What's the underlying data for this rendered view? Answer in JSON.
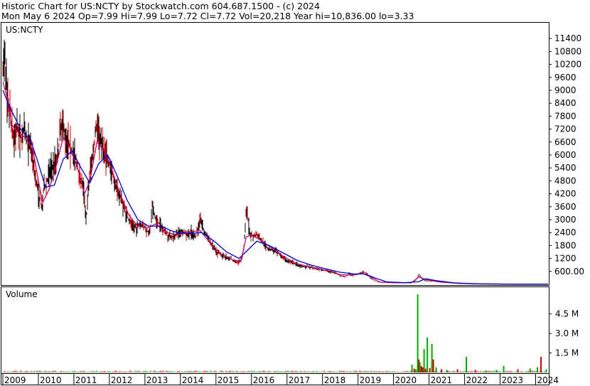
{
  "header": {
    "line1": "Historic Chart for US:NCTY by Stockwatch.com 604.687.1500 - (c) 2024",
    "line2": "Mon May  6 2024  Op=7.99  Hi=7.99  Lo=7.72  Cl=7.72  Vol=20,218  Year hi=10,836.00  lo=3.33"
  },
  "colors": {
    "price_up": "#000000",
    "price_down": "#cc0000",
    "ma_short": "#cc0066",
    "ma_long": "#0000cc",
    "vol_up": "#00aa00",
    "vol_down": "#cc0000"
  },
  "chart_data": [
    {
      "type": "line",
      "panel_label": "US:NCTY",
      "ylim": [
        0,
        12000
      ],
      "yticks": [
        "11400",
        "10800",
        "10200",
        "9600",
        "9000",
        "8400",
        "7800",
        "7200",
        "6600",
        "6000",
        "5400",
        "4800",
        "4200",
        "3600",
        "3000",
        "2400",
        "1800",
        "1200",
        "600.00"
      ],
      "ytick_values": [
        11400,
        10800,
        10200,
        9600,
        9000,
        8400,
        7800,
        7200,
        6600,
        6000,
        5400,
        4800,
        4200,
        3600,
        3000,
        2400,
        1800,
        1200,
        600
      ],
      "x_labels": [
        "2009",
        "2010",
        "2011",
        "2012",
        "2013",
        "2014",
        "2015",
        "2016",
        "2017",
        "2018",
        "2019",
        "2020",
        "2021",
        "2022",
        "2023",
        "2024"
      ],
      "x_label_values": [
        2009.0,
        2010.0,
        2011.0,
        2012.0,
        2013.0,
        2014.0,
        2015.0,
        2016.0,
        2017.0,
        2018.0,
        2019.0,
        2020.0,
        2021.0,
        2022.0,
        2023.0,
        2024.0
      ],
      "xlim": [
        2009.0,
        2024.37
      ],
      "price": [
        [
          2009.0,
          9800
        ],
        [
          2009.06,
          10836
        ],
        [
          2009.12,
          8400
        ],
        [
          2009.2,
          8000
        ],
        [
          2009.3,
          6800
        ],
        [
          2009.4,
          7200
        ],
        [
          2009.5,
          6800
        ],
        [
          2009.6,
          7100
        ],
        [
          2009.7,
          6600
        ],
        [
          2009.8,
          6400
        ],
        [
          2009.9,
          5200
        ],
        [
          2010.0,
          4200
        ],
        [
          2010.05,
          3800
        ],
        [
          2010.1,
          3500
        ],
        [
          2010.15,
          4400
        ],
        [
          2010.25,
          4800
        ],
        [
          2010.35,
          5400
        ],
        [
          2010.45,
          5600
        ],
        [
          2010.55,
          6000
        ],
        [
          2010.65,
          7600
        ],
        [
          2010.75,
          7000
        ],
        [
          2010.85,
          6600
        ],
        [
          2010.95,
          6200
        ],
        [
          2011.05,
          5800
        ],
        [
          2011.15,
          5200
        ],
        [
          2011.25,
          4600
        ],
        [
          2011.3,
          4000
        ],
        [
          2011.35,
          3000
        ],
        [
          2011.4,
          4200
        ],
        [
          2011.45,
          5200
        ],
        [
          2011.55,
          6200
        ],
        [
          2011.6,
          7000
        ],
        [
          2011.65,
          7400
        ],
        [
          2011.75,
          6800
        ],
        [
          2011.85,
          6200
        ],
        [
          2011.95,
          5800
        ],
        [
          2012.05,
          5300
        ],
        [
          2012.15,
          4700
        ],
        [
          2012.25,
          4300
        ],
        [
          2012.35,
          3900
        ],
        [
          2012.45,
          3400
        ],
        [
          2012.55,
          3000
        ],
        [
          2012.65,
          2700
        ],
        [
          2012.75,
          2600
        ],
        [
          2012.85,
          2800
        ],
        [
          2012.95,
          2700
        ],
        [
          2013.05,
          2500
        ],
        [
          2013.15,
          2400
        ],
        [
          2013.2,
          3600
        ],
        [
          2013.3,
          3000
        ],
        [
          2013.4,
          2800
        ],
        [
          2013.5,
          2600
        ],
        [
          2013.65,
          2300
        ],
        [
          2013.8,
          2200
        ],
        [
          2013.95,
          2400
        ],
        [
          2014.05,
          2500
        ],
        [
          2014.15,
          2300
        ],
        [
          2014.3,
          2400
        ],
        [
          2014.4,
          2200
        ],
        [
          2014.5,
          2600
        ],
        [
          2014.55,
          3200
        ],
        [
          2014.65,
          2500
        ],
        [
          2014.75,
          2200
        ],
        [
          2014.9,
          1800
        ],
        [
          2015.0,
          1500
        ],
        [
          2015.1,
          1400
        ],
        [
          2015.25,
          1300
        ],
        [
          2015.4,
          1200
        ],
        [
          2015.5,
          1100
        ],
        [
          2015.6,
          1000
        ],
        [
          2015.7,
          1100
        ],
        [
          2015.75,
          1300
        ],
        [
          2015.8,
          2000
        ],
        [
          2015.85,
          3500
        ],
        [
          2015.9,
          3000
        ],
        [
          2015.95,
          2400
        ],
        [
          2016.05,
          2200
        ],
        [
          2016.15,
          2300
        ],
        [
          2016.25,
          2100
        ],
        [
          2016.35,
          1900
        ],
        [
          2016.45,
          1700
        ],
        [
          2016.55,
          1600
        ],
        [
          2016.7,
          1500
        ],
        [
          2016.85,
          1300
        ],
        [
          2017.0,
          1100
        ],
        [
          2017.15,
          1000
        ],
        [
          2017.3,
          900
        ],
        [
          2017.45,
          850
        ],
        [
          2017.6,
          800
        ],
        [
          2017.75,
          750
        ],
        [
          2017.9,
          700
        ],
        [
          2018.05,
          650
        ],
        [
          2018.2,
          600
        ],
        [
          2018.35,
          550
        ],
        [
          2018.5,
          400
        ],
        [
          2018.65,
          350
        ],
        [
          2018.75,
          500
        ],
        [
          2018.85,
          400
        ],
        [
          2018.95,
          450
        ],
        [
          2019.05,
          500
        ],
        [
          2019.15,
          600
        ],
        [
          2019.25,
          500
        ],
        [
          2019.35,
          300
        ],
        [
          2019.5,
          120
        ],
        [
          2019.7,
          80
        ],
        [
          2019.9,
          70
        ],
        [
          2020.1,
          60
        ],
        [
          2020.3,
          60
        ],
        [
          2020.5,
          70
        ],
        [
          2020.65,
          200
        ],
        [
          2020.72,
          500
        ],
        [
          2020.78,
          300
        ],
        [
          2020.85,
          200
        ],
        [
          2020.95,
          150
        ],
        [
          2021.1,
          150
        ],
        [
          2021.3,
          100
        ],
        [
          2021.5,
          70
        ],
        [
          2021.7,
          50
        ],
        [
          2021.9,
          30
        ],
        [
          2022.2,
          20
        ],
        [
          2022.6,
          15
        ],
        [
          2023.0,
          12
        ],
        [
          2023.5,
          10
        ],
        [
          2024.0,
          9
        ],
        [
          2024.35,
          8
        ]
      ],
      "ma_short": [
        [
          2009.0,
          9400
        ],
        [
          2009.1,
          8800
        ],
        [
          2009.25,
          7400
        ],
        [
          2009.45,
          7000
        ],
        [
          2009.65,
          6800
        ],
        [
          2009.85,
          6200
        ],
        [
          2010.0,
          4800
        ],
        [
          2010.12,
          3800
        ],
        [
          2010.3,
          4400
        ],
        [
          2010.5,
          5500
        ],
        [
          2010.7,
          6800
        ],
        [
          2010.9,
          6300
        ],
        [
          2011.1,
          5400
        ],
        [
          2011.3,
          4200
        ],
        [
          2011.45,
          4800
        ],
        [
          2011.65,
          6600
        ],
        [
          2011.85,
          6200
        ],
        [
          2012.05,
          5400
        ],
        [
          2012.3,
          4200
        ],
        [
          2012.55,
          3200
        ],
        [
          2012.8,
          2700
        ],
        [
          2013.05,
          2600
        ],
        [
          2013.3,
          2800
        ],
        [
          2013.6,
          2400
        ],
        [
          2013.9,
          2300
        ],
        [
          2014.2,
          2400
        ],
        [
          2014.55,
          2500
        ],
        [
          2014.85,
          1900
        ],
        [
          2015.1,
          1450
        ],
        [
          2015.45,
          1150
        ],
        [
          2015.7,
          1050
        ],
        [
          2015.85,
          2200
        ],
        [
          2016.0,
          2300
        ],
        [
          2016.3,
          2000
        ],
        [
          2016.6,
          1650
        ],
        [
          2016.9,
          1300
        ],
        [
          2017.2,
          1000
        ],
        [
          2017.6,
          820
        ],
        [
          2017.9,
          720
        ],
        [
          2018.2,
          620
        ],
        [
          2018.5,
          450
        ],
        [
          2018.8,
          430
        ],
        [
          2019.1,
          520
        ],
        [
          2019.35,
          350
        ],
        [
          2019.6,
          110
        ],
        [
          2020.0,
          70
        ],
        [
          2020.5,
          70
        ],
        [
          2020.72,
          350
        ],
        [
          2020.9,
          220
        ],
        [
          2021.3,
          110
        ],
        [
          2021.8,
          45
        ],
        [
          2022.5,
          18
        ],
        [
          2023.5,
          11
        ],
        [
          2024.35,
          8
        ]
      ],
      "ma_long": [
        [
          2009.0,
          9000
        ],
        [
          2009.2,
          8200
        ],
        [
          2009.5,
          7200
        ],
        [
          2009.8,
          6600
        ],
        [
          2010.0,
          5600
        ],
        [
          2010.2,
          4500
        ],
        [
          2010.45,
          4600
        ],
        [
          2010.7,
          5800
        ],
        [
          2010.95,
          6200
        ],
        [
          2011.2,
          5400
        ],
        [
          2011.45,
          4700
        ],
        [
          2011.7,
          5600
        ],
        [
          2011.95,
          6000
        ],
        [
          2012.2,
          5100
        ],
        [
          2012.5,
          3900
        ],
        [
          2012.8,
          3000
        ],
        [
          2013.1,
          2700
        ],
        [
          2013.45,
          2700
        ],
        [
          2013.8,
          2450
        ],
        [
          2014.2,
          2350
        ],
        [
          2014.6,
          2400
        ],
        [
          2014.95,
          2000
        ],
        [
          2015.3,
          1500
        ],
        [
          2015.65,
          1200
        ],
        [
          2015.9,
          1600
        ],
        [
          2016.15,
          2000
        ],
        [
          2016.5,
          1800
        ],
        [
          2016.9,
          1450
        ],
        [
          2017.3,
          1100
        ],
        [
          2017.7,
          880
        ],
        [
          2018.1,
          720
        ],
        [
          2018.5,
          560
        ],
        [
          2018.9,
          480
        ],
        [
          2019.2,
          480
        ],
        [
          2019.5,
          280
        ],
        [
          2019.8,
          120
        ],
        [
          2020.3,
          75
        ],
        [
          2020.7,
          120
        ],
        [
          2020.9,
          260
        ],
        [
          2021.2,
          170
        ],
        [
          2021.7,
          70
        ],
        [
          2022.3,
          28
        ],
        [
          2023.2,
          14
        ],
        [
          2024.35,
          9
        ]
      ]
    },
    {
      "type": "bar",
      "panel_label": "Volume",
      "ylim": [
        0,
        6500000
      ],
      "yticks": [
        "4.5 M",
        "3.0 M",
        "1.5 M"
      ],
      "ytick_values": [
        4500000,
        3000000,
        1500000
      ],
      "bars": [
        [
          2020.52,
          600000,
          "up"
        ],
        [
          2020.58,
          300000,
          "down"
        ],
        [
          2020.63,
          250000,
          "up"
        ],
        [
          2020.68,
          6000000,
          "up"
        ],
        [
          2020.71,
          1000000,
          "down"
        ],
        [
          2020.74,
          800000,
          "up"
        ],
        [
          2020.78,
          500000,
          "down"
        ],
        [
          2020.82,
          400000,
          "down"
        ],
        [
          2020.86,
          1800000,
          "up"
        ],
        [
          2020.9,
          300000,
          "down"
        ],
        [
          2020.95,
          2700000,
          "up"
        ],
        [
          2021.02,
          350000,
          "down"
        ],
        [
          2021.08,
          2200000,
          "up"
        ],
        [
          2021.12,
          1000000,
          "down"
        ],
        [
          2021.2,
          400000,
          "up"
        ],
        [
          2021.35,
          250000,
          "down"
        ],
        [
          2021.5,
          200000,
          "up"
        ],
        [
          2021.8,
          250000,
          "down"
        ],
        [
          2022.05,
          1200000,
          "up"
        ],
        [
          2022.3,
          200000,
          "down"
        ],
        [
          2022.6,
          150000,
          "up"
        ],
        [
          2022.9,
          200000,
          "up"
        ],
        [
          2023.1,
          500000,
          "up"
        ],
        [
          2023.5,
          250000,
          "down"
        ],
        [
          2023.85,
          300000,
          "up"
        ],
        [
          2024.05,
          400000,
          "up"
        ],
        [
          2024.15,
          1200000,
          "down"
        ],
        [
          2024.3,
          250000,
          "up"
        ]
      ],
      "baseline_noise_level": 120000
    }
  ]
}
